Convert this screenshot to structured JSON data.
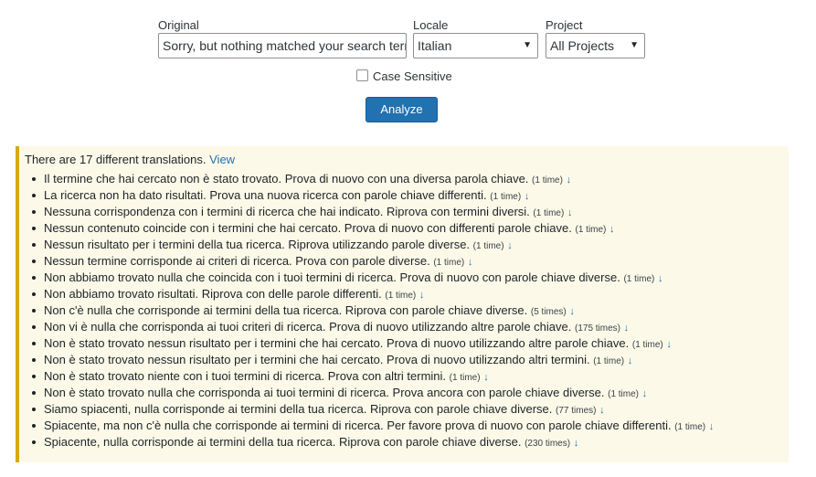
{
  "form": {
    "original_label": "Original",
    "original_value": "Sorry, but nothing matched your search terms. Please try again with some different keywords.",
    "locale_label": "Locale",
    "locale_value": "Italian",
    "project_label": "Project",
    "project_value": "All Projects",
    "case_sensitive_label": "Case Sensitive",
    "case_sensitive_checked": false,
    "analyze_label": "Analyze"
  },
  "results": {
    "summary": "There are 17 different translations.",
    "view_link": "View",
    "arrow": "↓",
    "translations": [
      {
        "text": "Il termine che hai cercato non è stato trovato. Prova di nuovo con una diversa parola chiave.",
        "count": "(1 time)"
      },
      {
        "text": "La ricerca non ha dato risultati. Prova una nuova ricerca con parole chiave differenti.",
        "count": "(1 time)"
      },
      {
        "text": "Nessuna corrispondenza con i termini di ricerca che hai indicato. Riprova con termini diversi.",
        "count": "(1 time)"
      },
      {
        "text": "Nessun contenuto coincide con i termini che hai cercato. Prova di nuovo con differenti parole chiave.",
        "count": "(1 time)"
      },
      {
        "text": "Nessun risultato per i termini della tua ricerca. Riprova utilizzando parole diverse.",
        "count": "(1 time)"
      },
      {
        "text": "Nessun termine corrisponde ai criteri di ricerca. Prova con parole diverse.",
        "count": "(1 time)"
      },
      {
        "text": "Non abbiamo trovato nulla che coincida con i tuoi termini di ricerca. Prova di nuovo con parole chiave diverse.",
        "count": "(1 time)"
      },
      {
        "text": "Non abbiamo trovato risultati. Riprova con delle parole differenti.",
        "count": "(1 time)"
      },
      {
        "text": "Non c'è nulla che corrisponde ai termini della tua ricerca. Riprova con parole chiave diverse.",
        "count": "(5 times)"
      },
      {
        "text": "Non vi è nulla che corrisponda ai tuoi criteri di ricerca. Prova di nuovo utilizzando altre parole chiave.",
        "count": "(175 times)"
      },
      {
        "text": "Non è stato trovato nessun risultato per i termini che hai cercato. Prova di nuovo utilizzando altre parole chiave.",
        "count": "(1 time)"
      },
      {
        "text": "Non è stato trovato nessun risultato per i termini che hai cercato. Prova di nuovo utilizzando altri termini.",
        "count": "(1 time)"
      },
      {
        "text": "Non è stato trovato niente con i tuoi termini di ricerca. Prova con altri termini.",
        "count": "(1 time)"
      },
      {
        "text": "Non è stato trovato nulla che corrisponda ai tuoi termini di ricerca. Prova ancora con parole chiave diverse.",
        "count": "(1 time)"
      },
      {
        "text": "Siamo spiacenti, nulla corrisponde ai termini della tua ricerca. Riprova con parole chiave diverse.",
        "count": "(77 times)"
      },
      {
        "text": "Spiacente, ma non c'è nulla che corrisponde ai termini di ricerca. Per favore prova di nuovo con parole chiave differenti.",
        "count": "(1 time)"
      },
      {
        "text": "Spiacente, nulla corrisponde ai termini della tua ricerca. Riprova con parole chiave diverse.",
        "count": "(230 times)"
      }
    ]
  },
  "colors": {
    "button": "#2271b1",
    "link": "#2271b1",
    "notice_background": "#fcf9e8",
    "notice_border": "#dba617"
  }
}
